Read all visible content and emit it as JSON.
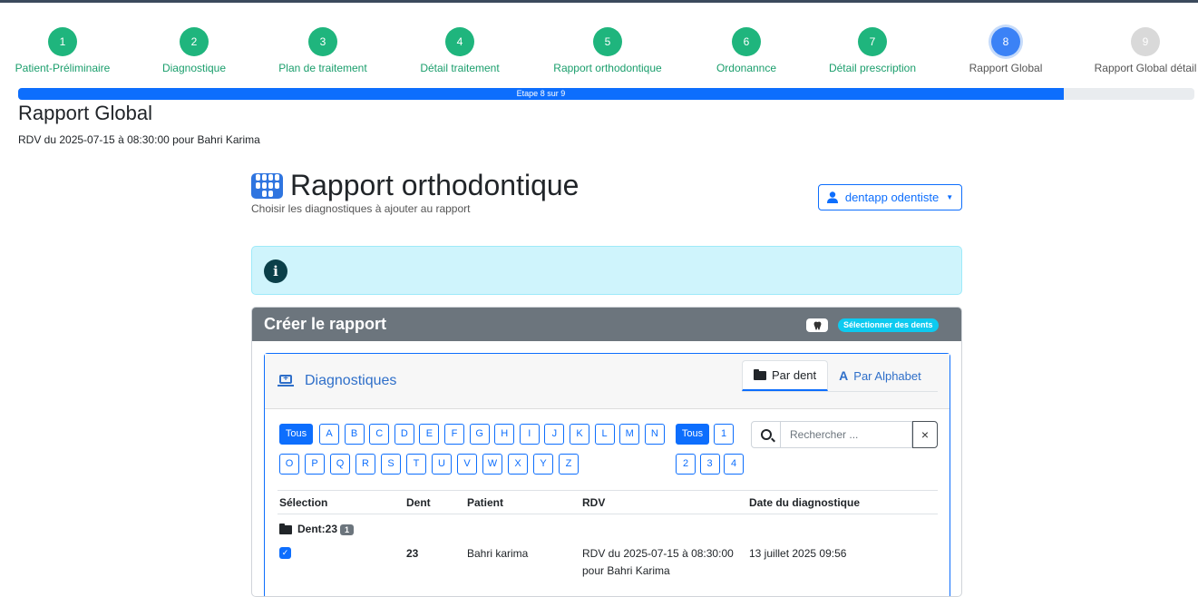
{
  "stepper": {
    "steps": [
      {
        "num": "1",
        "label": "Patient-Préliminaire",
        "state": "done"
      },
      {
        "num": "2",
        "label": "Diagnostique",
        "state": "done"
      },
      {
        "num": "3",
        "label": "Plan de traitement",
        "state": "done"
      },
      {
        "num": "4",
        "label": "Détail traitement",
        "state": "done"
      },
      {
        "num": "5",
        "label": "Rapport orthodontique",
        "state": "done"
      },
      {
        "num": "6",
        "label": "Ordonannce",
        "state": "done"
      },
      {
        "num": "7",
        "label": "Détail prescription",
        "state": "done"
      },
      {
        "num": "8",
        "label": "Rapport Global",
        "state": "current"
      },
      {
        "num": "9",
        "label": "Rapport Global détail",
        "state": "todo"
      }
    ],
    "progress_text": "Etape 8 sur 9",
    "progress_fraction": 0.8889
  },
  "page": {
    "title": "Rapport Global",
    "subtitle": "RDV du 2025-07-15 à 08:30:00 pour Bahri Karima"
  },
  "report": {
    "title": "Rapport orthodontique",
    "subtitle": "Choisir les diagnostiques à ajouter au rapport",
    "user_button": "dentapp odentiste"
  },
  "card": {
    "title": "Créer le rapport",
    "select_teeth": "Sélectionner des dents"
  },
  "diagnostics": {
    "title": "Diagnostiques",
    "tab_by_tooth": "Par dent",
    "tab_alphabet": "Par Alphabet",
    "all_letters": "Tous",
    "letters_row1": [
      "A",
      "B",
      "C",
      "D",
      "E",
      "F",
      "G",
      "H",
      "I",
      "J",
      "K",
      "L",
      "M",
      "N"
    ],
    "letters_row2": [
      "O",
      "P",
      "Q",
      "R",
      "S",
      "T",
      "U",
      "V",
      "W",
      "X",
      "Y",
      "Z"
    ],
    "all_numbers": "Tous",
    "numbers_row1": [
      "1"
    ],
    "numbers_row2": [
      "2",
      "3",
      "4"
    ],
    "search_placeholder": "Rechercher ...",
    "clear": "×"
  },
  "table": {
    "headers": {
      "selection": "Sélection",
      "tooth": "Dent",
      "patient": "Patient",
      "rdv": "RDV",
      "date": "Date du diagnostique"
    },
    "group": {
      "label": "Dent:23",
      "count": "1"
    },
    "rows": [
      {
        "tooth": "23",
        "patient": "Bahri karima",
        "rdv": "RDV du 2025-07-15 à 08:30:00 pour Bahri Karima",
        "date": "13 juillet 2025 09:56"
      }
    ]
  }
}
